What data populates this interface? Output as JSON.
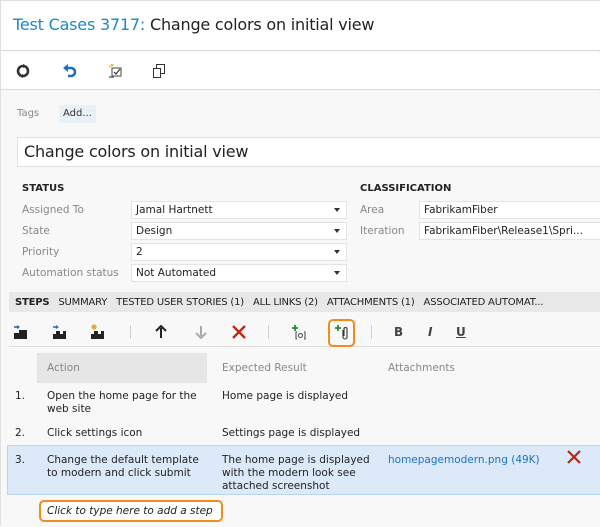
{
  "header": {
    "type_label": "Test Cases 3717:",
    "title": "Change colors on initial view"
  },
  "toolbar": {
    "icons": [
      "refresh-icon",
      "undo-icon",
      "new-linked-item-icon",
      "copy-icon"
    ]
  },
  "tags": {
    "label": "Tags",
    "add_label": "Add..."
  },
  "title_field": {
    "value": "Change colors on initial view"
  },
  "status": {
    "heading": "STATUS",
    "fields": [
      {
        "label": "Assigned To",
        "value": "Jamal Hartnett"
      },
      {
        "label": "State",
        "value": "Design"
      },
      {
        "label": "Priority",
        "value": "2"
      },
      {
        "label": "Automation status",
        "value": "Not Automated"
      }
    ]
  },
  "classification": {
    "heading": "CLASSIFICATION",
    "fields": [
      {
        "label": "Area",
        "value": "FabrikamFiber"
      },
      {
        "label": "Iteration",
        "value": "FabrikamFiber\\Release1\\Spri..."
      }
    ]
  },
  "tabs": [
    {
      "label": "STEPS",
      "active": true
    },
    {
      "label": "SUMMARY"
    },
    {
      "label": "TESTED USER STORIES (1)"
    },
    {
      "label": "ALL LINKS (2)"
    },
    {
      "label": "ATTACHMENTS (1)"
    },
    {
      "label": "ASSOCIATED AUTOMAT..."
    }
  ],
  "steps_toolbar": {
    "bold": "B",
    "italic": "I",
    "underline": "U"
  },
  "steps": {
    "columns": [
      "Action",
      "Expected Result",
      "Attachments"
    ],
    "rows": [
      {
        "num": "1.",
        "action": "Open the home page for the web site",
        "action_lines": [
          "Open the home page for the",
          "web site"
        ],
        "expected": "Home page is displayed",
        "attachment": ""
      },
      {
        "num": "2.",
        "action": "Click settings icon",
        "expected": "Settings page is displayed",
        "attachment": ""
      },
      {
        "num": "3.",
        "action": "Change the default template to modern and click submit",
        "action_lines": [
          "Change the default template",
          "to modern and click submit"
        ],
        "expected": "The home page is displayed with the modern look see attached screenshot",
        "expected_lines": [
          "The home page is displayed",
          "with the modern look see",
          "attached screenshot"
        ],
        "attachment": "homepagemodern.png (49K)",
        "selected": true
      }
    ],
    "add_step_placeholder": "Click to type here to add a step"
  },
  "colors": {
    "accent": "#1e88c7",
    "highlight": "#f28c1a",
    "selected_row": "#dbe9f8",
    "delete": "#c0281c"
  }
}
